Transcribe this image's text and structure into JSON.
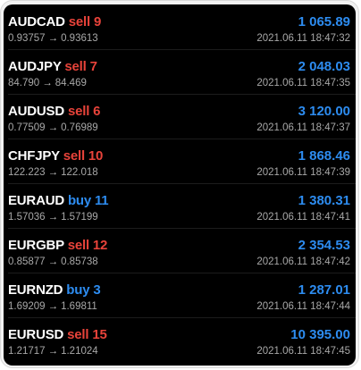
{
  "positions": [
    {
      "symbol": "AUDCAD",
      "action": "sell",
      "volume": "9",
      "profit": "1 065.89",
      "open_price": "0.93757",
      "close_price": "0.93613",
      "time": "2021.06.11 18:47:32"
    },
    {
      "symbol": "AUDJPY",
      "action": "sell",
      "volume": "7",
      "profit": "2 048.03",
      "open_price": "84.790",
      "close_price": "84.469",
      "time": "2021.06.11 18:47:35"
    },
    {
      "symbol": "AUDUSD",
      "action": "sell",
      "volume": "6",
      "profit": "3 120.00",
      "open_price": "0.77509",
      "close_price": "0.76989",
      "time": "2021.06.11 18:47:37"
    },
    {
      "symbol": "CHFJPY",
      "action": "sell",
      "volume": "10",
      "profit": "1 868.46",
      "open_price": "122.223",
      "close_price": "122.018",
      "time": "2021.06.11 18:47:39"
    },
    {
      "symbol": "EURAUD",
      "action": "buy",
      "volume": "11",
      "profit": "1 380.31",
      "open_price": "1.57036",
      "close_price": "1.57199",
      "time": "2021.06.11 18:47:41"
    },
    {
      "symbol": "EURGBP",
      "action": "sell",
      "volume": "12",
      "profit": "2 354.53",
      "open_price": "0.85877",
      "close_price": "0.85738",
      "time": "2021.06.11 18:47:42"
    },
    {
      "symbol": "EURNZD",
      "action": "buy",
      "volume": "3",
      "profit": "1 287.01",
      "open_price": "1.69209",
      "close_price": "1.69811",
      "time": "2021.06.11 18:47:44"
    },
    {
      "symbol": "EURUSD",
      "action": "sell",
      "volume": "15",
      "profit": "10 395.00",
      "open_price": "1.21717",
      "close_price": "1.21024",
      "time": "2021.06.11 18:47:45"
    }
  ],
  "arrow_glyph": "→",
  "colors": {
    "sell": "#e8433a",
    "buy": "#2d8cf0",
    "profit": "#2d8cf0",
    "symbol": "#ffffff",
    "secondary_text": "#a8a8a8",
    "background": "#000000"
  }
}
